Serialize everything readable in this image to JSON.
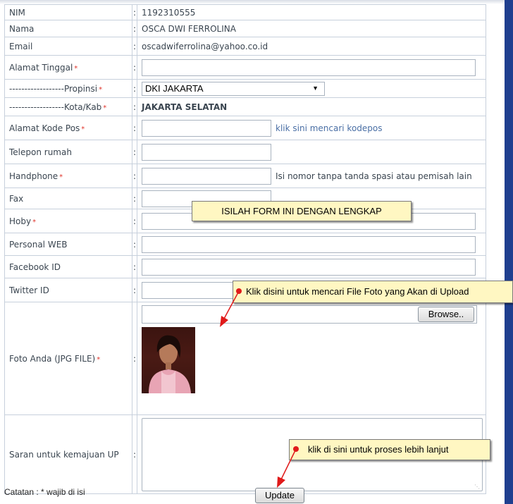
{
  "form": {
    "rows": [
      {
        "label": "NIM",
        "sep": ":",
        "value": "1192310555"
      },
      {
        "label": "Nama",
        "sep": ":",
        "value": "OSCA DWI FERROLINA"
      },
      {
        "label": "Email",
        "sep": ":",
        "value": "oscadwiferrolina@yahoo.co.id"
      },
      {
        "label": "Alamat Tinggal",
        "sep": ":"
      },
      {
        "label": "------------------Propinsi",
        "sep": ":",
        "value": "DKI JAKARTA"
      },
      {
        "label": "------------------Kota/Kab",
        "sep": ":",
        "value": "JAKARTA SELATAN"
      },
      {
        "label": "Alamat Kode Pos",
        "sep": ":",
        "link": "klik sini mencari kodepos"
      },
      {
        "label": "Telepon rumah",
        "sep": ":"
      },
      {
        "label": "Handphone",
        "sep": ":",
        "hint": "Isi nomor tanpa tanda spasi atau pemisah lain"
      },
      {
        "label": "Fax",
        "sep": ":"
      },
      {
        "label": "Hoby",
        "sep": ":"
      },
      {
        "label": "Personal WEB",
        "sep": ":"
      },
      {
        "label": "Facebook ID",
        "sep": ":"
      },
      {
        "label": "Twitter ID",
        "sep": ":"
      },
      {
        "label": "Foto Anda (JPG FILE)",
        "sep": ":",
        "button": "Browse.."
      },
      {
        "label": "Saran untuk kemajuan UP",
        "sep": ":"
      }
    ],
    "required_mark": "*"
  },
  "footer": {
    "note": "Catatan : * wajib di isi",
    "update_label": "Update"
  },
  "callouts": {
    "form": "ISILAH FORM INI DENGAN LENGKAP",
    "upload": "Klik disini untuk mencari File Foto yang Akan di Upload",
    "process": "klik di sini untuk proses lebih lanjut"
  },
  "colors": {
    "required": "#e0342b",
    "link": "#4a6fa5",
    "callout_bg": "#fff7c2",
    "arrow": "#e01a1a",
    "sidebar": "#1f3f8f"
  }
}
